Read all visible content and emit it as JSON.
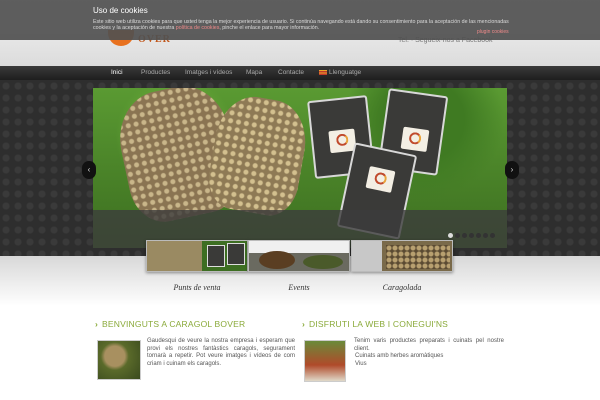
{
  "header": {
    "logo_text": "OVER",
    "right_text": "Tel. · Segueix-nos a Facebook"
  },
  "cookie": {
    "title": "Uso de cookies",
    "text": "Este sitio web utiliza cookies para que usted tenga la mejor experiencia de usuario. Si continúa navegando está dando su consentimiento para la aceptación de las mencionadas cookies y la aceptación de nuestra",
    "link": "política de cookies",
    "tail": ", pinche el enlace para mayor información.",
    "plugin": "plugin cookies"
  },
  "nav": {
    "items": [
      "Inici",
      "Productes",
      "Imatges i vídeos",
      "Mapa",
      "Contacte"
    ],
    "language": "Llenguatge"
  },
  "slider": {
    "prev": "‹",
    "next": "›",
    "dots_total": 7,
    "active_dot": 0
  },
  "thumbs": [
    {
      "label": "Punts de venta"
    },
    {
      "label": "Events"
    },
    {
      "label": "Caragolada"
    }
  ],
  "sections": {
    "welcome_title": "BENVINGUTS A CARAGOL BOVER",
    "welcome_text": "Gaudesqui de veure la nostra empresa i esperam que provi els nostres fantàstics caragols, segurament tornarà a repetir. Pot veure imatges i vídeos de com criam i cuinam els caragols.",
    "enjoy_title": "DISFRUTI LA WEB I CONEGUI'NS",
    "enjoy_text": "Tenim varis productes preparats i cuinats pel nostre client.",
    "enjoy_items": [
      "Cuinats amb herbes aromàtiques",
      "Vius"
    ]
  },
  "colors": {
    "accent": "#8aaa3a",
    "brand": "#e8711f",
    "cookie_link": "#f08a8a"
  }
}
